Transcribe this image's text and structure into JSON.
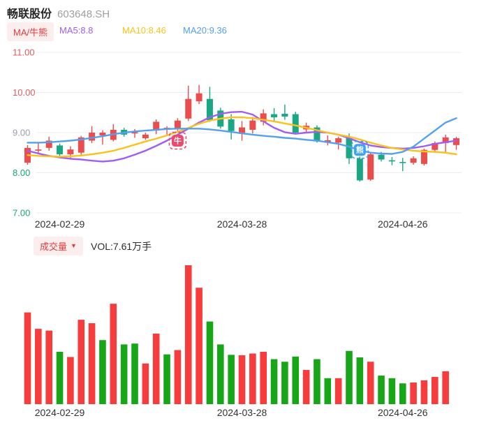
{
  "header": {
    "title": "畅联股份",
    "code": "603648.SH"
  },
  "legend": {
    "ma_toggle": "MA/牛熊",
    "ma5": "MA5:8.8",
    "ma10": "MA10:8.46",
    "ma20": "MA20:9.36"
  },
  "volume_legend": {
    "toggle": "成交量",
    "dropdown_icon": "▼",
    "vol": "VOL:7.61万手"
  },
  "colors": {
    "candle_up": "#eb4d4d",
    "candle_down": "#1ba784",
    "vol_up": "#f63c3c",
    "vol_down": "#17a617",
    "ma5": "#a05cf5",
    "ma10": "#fbc21c",
    "ma20": "#54a0f0",
    "chip_text": "#e23c3c",
    "chip_bg": "#fdeeee",
    "grid": "#e8ecf4",
    "tick_red": "#e05c5c",
    "tick_green": "#18a679",
    "tick_gray": "#9aa0a8",
    "axis_text": "#333333",
    "marker_bull": "#f2476c",
    "marker_bear": "#3ba4f5"
  },
  "chart_data": [
    {
      "type": "candlestick",
      "title": "畅联股份 603648.SH 日K",
      "ylim": [
        6.9,
        11.26
      ],
      "y_ticks": [
        {
          "label": "11.00",
          "value": 11,
          "color_key": "tick_red"
        },
        {
          "label": "10.00",
          "value": 10,
          "color_key": "tick_red"
        },
        {
          "label": "9.00",
          "value": 9,
          "color_key": "tick_gray"
        },
        {
          "label": "8.00",
          "value": 8,
          "color_key": "tick_green"
        },
        {
          "label": "7.00",
          "value": 7,
          "color_key": "tick_green"
        }
      ],
      "x_ticks": [
        {
          "index": 3,
          "label": "2024-02-29"
        },
        {
          "index": 20,
          "label": "2024-03-28"
        },
        {
          "index": 35,
          "label": "2024-04-26"
        }
      ],
      "candle_columns": [
        "open",
        "high",
        "low",
        "close",
        "direction"
      ],
      "candles": [
        [
          8.25,
          8.69,
          8.2,
          8.62,
          "u"
        ],
        [
          8.55,
          8.76,
          8.47,
          8.58,
          "u"
        ],
        [
          8.62,
          8.9,
          8.55,
          8.8,
          "u"
        ],
        [
          8.68,
          8.73,
          8.4,
          8.46,
          "d"
        ],
        [
          8.46,
          8.66,
          8.36,
          8.58,
          "u"
        ],
        [
          8.5,
          8.92,
          8.45,
          8.88,
          "u"
        ],
        [
          8.8,
          9.16,
          8.74,
          9.0,
          "u"
        ],
        [
          8.93,
          9.06,
          8.7,
          9.0,
          "u"
        ],
        [
          8.82,
          9.21,
          8.78,
          9.07,
          "u"
        ],
        [
          9.07,
          9.12,
          8.9,
          8.95,
          "d"
        ],
        [
          8.98,
          9.09,
          8.87,
          9.01,
          "u"
        ],
        [
          8.86,
          9.0,
          8.82,
          8.95,
          "u"
        ],
        [
          9.05,
          9.33,
          8.96,
          9.27,
          "u"
        ],
        [
          9.12,
          9.16,
          8.95,
          9.12,
          "u"
        ],
        [
          9.08,
          9.36,
          9.04,
          9.3,
          "u"
        ],
        [
          9.35,
          10.17,
          9.29,
          9.84,
          "u"
        ],
        [
          9.78,
          10.19,
          9.71,
          9.98,
          "u"
        ],
        [
          9.84,
          10.14,
          9.27,
          9.31,
          "d"
        ],
        [
          9.55,
          9.62,
          9.1,
          9.15,
          "d"
        ],
        [
          9.33,
          9.46,
          8.83,
          9.04,
          "d"
        ],
        [
          8.97,
          9.29,
          8.8,
          9.13,
          "u"
        ],
        [
          9.07,
          9.39,
          8.98,
          9.3,
          "u"
        ],
        [
          9.27,
          9.58,
          9.18,
          9.48,
          "u"
        ],
        [
          9.46,
          9.61,
          9.29,
          9.38,
          "d"
        ],
        [
          9.47,
          9.7,
          9.32,
          9.4,
          "d"
        ],
        [
          9.46,
          9.52,
          8.98,
          9.0,
          "d"
        ],
        [
          9.08,
          9.25,
          9.0,
          9.17,
          "u"
        ],
        [
          9.13,
          9.18,
          8.75,
          8.78,
          "d"
        ],
        [
          8.76,
          8.93,
          8.68,
          8.81,
          "u"
        ],
        [
          8.75,
          8.9,
          8.58,
          8.86,
          "u"
        ],
        [
          8.86,
          8.98,
          8.22,
          8.36,
          "d"
        ],
        [
          8.35,
          8.4,
          7.78,
          7.81,
          "d"
        ],
        [
          7.83,
          8.52,
          7.8,
          8.46,
          "u"
        ],
        [
          8.45,
          8.52,
          8.28,
          8.33,
          "d"
        ],
        [
          8.31,
          8.39,
          8.19,
          8.29,
          "d"
        ],
        [
          8.27,
          8.37,
          8.04,
          8.25,
          "d"
        ],
        [
          8.25,
          8.41,
          8.2,
          8.36,
          "u"
        ],
        [
          8.22,
          8.6,
          8.18,
          8.57,
          "u"
        ],
        [
          8.57,
          8.78,
          8.5,
          8.74,
          "u"
        ],
        [
          8.74,
          8.95,
          8.52,
          8.88,
          "u"
        ],
        [
          8.69,
          8.9,
          8.57,
          8.86,
          "u"
        ]
      ],
      "series": [
        {
          "name": "MA5",
          "value_label": "MA5:8.8",
          "color_key": "ma5",
          "values": [
            8.55,
            8.48,
            8.42,
            8.38,
            8.35,
            8.33,
            8.3,
            8.28,
            8.3,
            8.36,
            8.45,
            8.55,
            8.67,
            8.8,
            8.95,
            9.1,
            9.25,
            9.38,
            9.47,
            9.51,
            9.52,
            9.45,
            9.28,
            9.12,
            9.01,
            8.97,
            9.0,
            9.02,
            9.0,
            8.95,
            8.86,
            8.76,
            8.68,
            8.64,
            8.62,
            8.6,
            8.62,
            8.66,
            8.72,
            8.76,
            8.8
          ]
        },
        {
          "name": "MA10",
          "value_label": "MA10:8.46",
          "color_key": "ma10",
          "values": [
            8.44,
            8.42,
            8.41,
            8.4,
            8.41,
            8.43,
            8.46,
            8.5,
            8.55,
            8.62,
            8.7,
            8.78,
            8.85,
            8.93,
            9.02,
            9.12,
            9.22,
            9.3,
            9.35,
            9.38,
            9.38,
            9.36,
            9.32,
            9.28,
            9.23,
            9.18,
            9.12,
            9.06,
            9.0,
            8.95,
            8.9,
            8.83,
            8.75,
            8.68,
            8.62,
            8.58,
            8.55,
            8.53,
            8.52,
            8.5,
            8.46
          ]
        },
        {
          "name": "MA20",
          "value_label": "MA20:9.36",
          "color_key": "ma20",
          "values": [
            8.75,
            8.75,
            8.76,
            8.78,
            8.8,
            8.83,
            8.87,
            8.91,
            8.96,
            9.0,
            9.03,
            9.05,
            9.07,
            9.09,
            9.1,
            9.1,
            9.1,
            9.08,
            9.05,
            9.02,
            8.98,
            8.95,
            8.92,
            8.9,
            8.87,
            8.85,
            8.82,
            8.8,
            8.76,
            8.72,
            8.65,
            8.56,
            8.5,
            8.48,
            8.47,
            8.52,
            8.65,
            8.85,
            9.05,
            9.25,
            9.36
          ]
        }
      ],
      "markers": [
        {
          "glyph": "牛",
          "name": "bull-marker",
          "index": 14,
          "price": 8.8,
          "color_key": "marker_bull"
        },
        {
          "glyph": "熊",
          "name": "bear-marker",
          "index": 31,
          "price": 8.57,
          "color_key": "marker_bear"
        }
      ]
    },
    {
      "type": "bar",
      "name": "成交量",
      "unit": "万手",
      "latest_label": "VOL:7.61万手",
      "bar_columns": [
        "value",
        "direction"
      ],
      "bars": [
        [
          21.2,
          "u"
        ],
        [
          17.4,
          "u"
        ],
        [
          17.0,
          "u"
        ],
        [
          12.1,
          "d"
        ],
        [
          10.9,
          "u"
        ],
        [
          19.5,
          "u"
        ],
        [
          18.7,
          "u"
        ],
        [
          14.8,
          "d"
        ],
        [
          23.2,
          "u"
        ],
        [
          13.8,
          "d"
        ],
        [
          14.0,
          "d"
        ],
        [
          9.4,
          "u"
        ],
        [
          16.3,
          "u"
        ],
        [
          11.5,
          "d"
        ],
        [
          12.5,
          "u"
        ],
        [
          32.1,
          "u"
        ],
        [
          26.9,
          "u"
        ],
        [
          19.1,
          "d"
        ],
        [
          13.8,
          "d"
        ],
        [
          11.4,
          "d"
        ],
        [
          11.3,
          "u"
        ],
        [
          11.7,
          "u"
        ],
        [
          12.1,
          "u"
        ],
        [
          10.4,
          "d"
        ],
        [
          9.8,
          "d"
        ],
        [
          11.0,
          "d"
        ],
        [
          7.9,
          "u"
        ],
        [
          10.4,
          "d"
        ],
        [
          6.0,
          "d"
        ],
        [
          6.0,
          "u"
        ],
        [
          12.3,
          "d"
        ],
        [
          10.8,
          "d"
        ],
        [
          9.8,
          "u"
        ],
        [
          6.6,
          "d"
        ],
        [
          6.0,
          "d"
        ],
        [
          4.8,
          "d"
        ],
        [
          5.0,
          "u"
        ],
        [
          5.5,
          "u"
        ],
        [
          6.3,
          "u"
        ],
        [
          7.61,
          "u"
        ]
      ],
      "x_ticks": [
        {
          "index": 3,
          "label": "2024-02-29"
        },
        {
          "index": 20,
          "label": "2024-03-28"
        },
        {
          "index": 35,
          "label": "2024-04-26"
        }
      ]
    }
  ]
}
